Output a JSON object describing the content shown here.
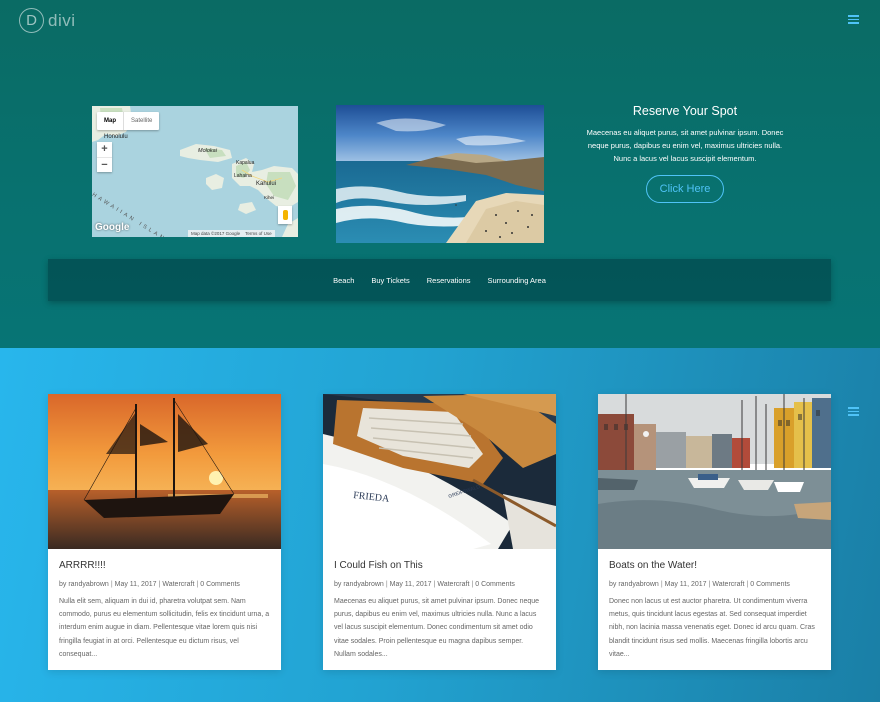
{
  "header": {
    "logo_letter": "D",
    "logo_text": "divi"
  },
  "map": {
    "type_map": "Map",
    "type_satellite": "Satellite",
    "zoom_in": "+",
    "zoom_out": "−",
    "labels": {
      "honolulu": "Honolulu",
      "molokai": "Molokai",
      "kapalua": "Kapalua",
      "lahaina": "Lahaina",
      "kahului": "Kahului",
      "kihei": "Kihei",
      "hawaiian_islands": "HAWAIIAN ISLANDS"
    },
    "google": "Google",
    "map_data": "Map data ©2017 Google",
    "terms": "Terms of Use"
  },
  "reserve": {
    "title": "Reserve Your Spot",
    "text": "Maecenas eu aliquet purus, sit amet pulvinar ipsum. Donec neque purus, dapibus eu enim vel, maximus ultricies nulla. Nunc a lacus vel lacus suscipit elementum.",
    "button": "Click Here"
  },
  "nav": {
    "items": [
      "Beach",
      "Buy Tickets",
      "Reservations",
      "Surrounding Area"
    ]
  },
  "posts": [
    {
      "title": "ARRRR!!!!",
      "author": "by randyabrown",
      "date": "May 11, 2017",
      "category": "Watercraft",
      "comments": "0 Comments",
      "excerpt": "Nulla elit sem, aliquam in dui id, pharetra volutpat sem. Nam commodo, purus eu elementum sollicitudin, felis ex tincidunt urna, a interdum enim augue in diam. Pellentesque vitae lorem quis nisi fringilla feugiat in at orci. Pellentesque eu dictum risus, vel consequat..."
    },
    {
      "title": "I Could Fish on This",
      "author": "by randyabrown",
      "date": "May 11, 2017",
      "category": "Watercraft",
      "comments": "0 Comments",
      "excerpt": "Maecenas eu aliquet purus, sit amet pulvinar ipsum. Donec neque purus, dapibus eu enim vel, maximus ultricies nulla. Nunc a lacus vel lacus suscipit elementum. Donec condimentum sit amet odio vitae sodales. Proin pellentesque eu magna dapibus semper. Nullam sodales..."
    },
    {
      "title": "Boats on the Water!",
      "author": "by randyabrown",
      "date": "May 11, 2017",
      "category": "Watercraft",
      "comments": "0 Comments",
      "excerpt": "Donec non lacus ut est auctor pharetra. Ut condimentum viverra metus, quis tincidunt lacus egestas at. Sed consequat imperdiet nibh, non lacinia massa venenatis eget. Donec id arcu quam. Cras blandit tincidunt risus sed mollis. Maecenas fringilla lobortis arcu vitae..."
    }
  ],
  "boat_names": {
    "frieda": "FRIEDA",
    "greifswald": "GREIFSWALD"
  },
  "colors": {
    "accent": "#4fc3f7",
    "top_bg": "#08716f",
    "bottom_bg": "#22a3d2"
  }
}
